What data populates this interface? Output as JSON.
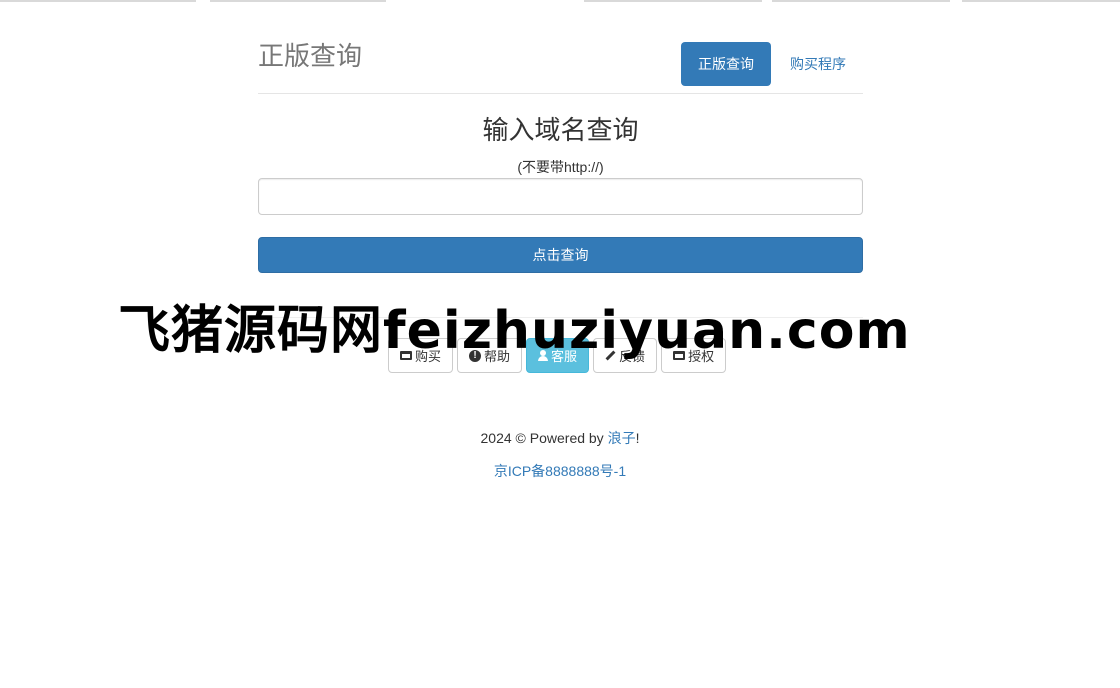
{
  "header": {
    "title": "正版查询",
    "nav": [
      {
        "label": "正版查询",
        "active": true
      },
      {
        "label": "购买程序",
        "active": false
      }
    ]
  },
  "query": {
    "title": "输入域名查询",
    "hint": "(不要带http://)",
    "input_value": "",
    "input_placeholder": "",
    "submit_label": "点击查询"
  },
  "actions": [
    {
      "label": "购买",
      "icon": "credit-card-icon"
    },
    {
      "label": "帮助",
      "icon": "exclamation-circle-icon"
    },
    {
      "label": "客服",
      "icon": "user-icon"
    },
    {
      "label": "反馈",
      "icon": "pencil-icon"
    },
    {
      "label": "授权",
      "icon": "credit-card-icon"
    }
  ],
  "watermark": "飞猪源码网feizhuziyuan.com",
  "footer": {
    "copyright_prefix": "2024 © Powered by ",
    "author": "浪子",
    "suffix": "!",
    "icp": "京ICP备8888888号-1"
  },
  "colors": {
    "primary": "#337ab7",
    "info": "#5bc0de",
    "muted": "#777777"
  }
}
